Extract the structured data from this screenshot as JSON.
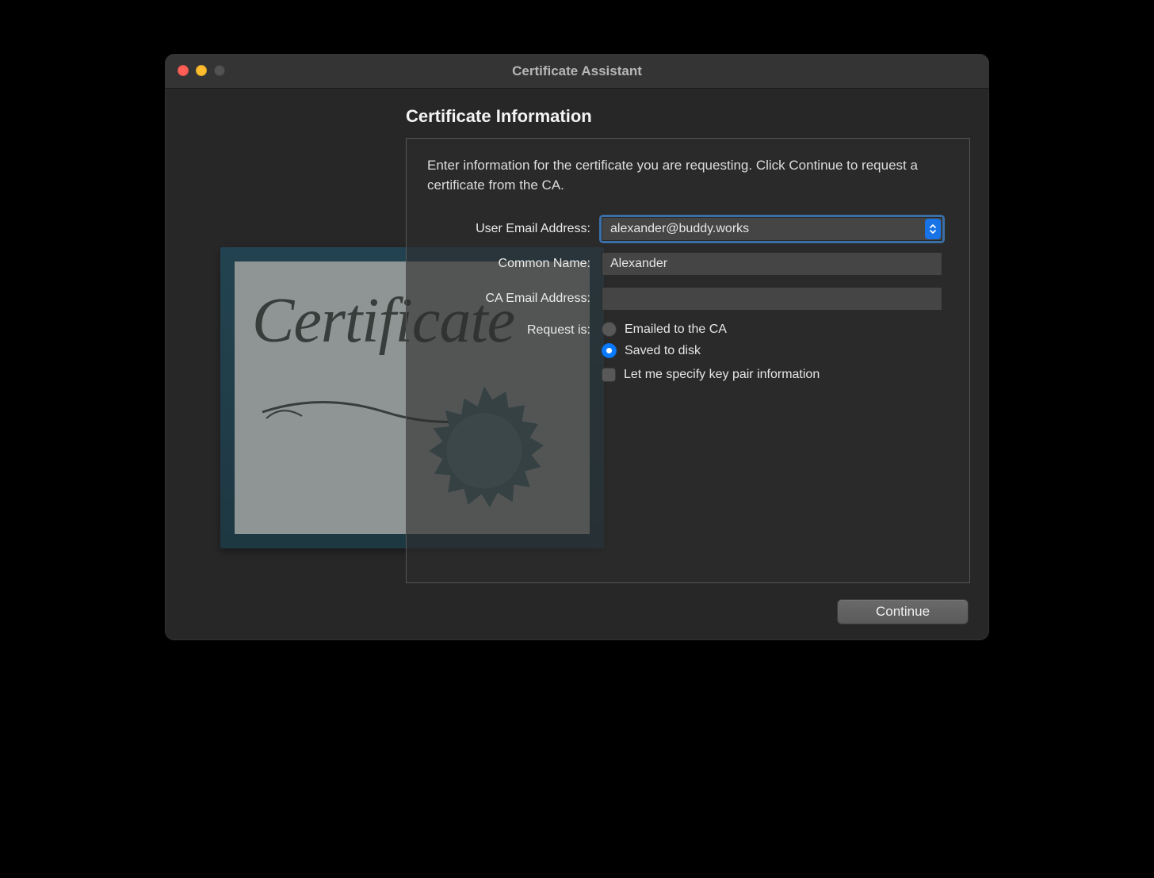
{
  "window": {
    "title": "Certificate Assistant"
  },
  "heading": "Certificate Information",
  "intro": "Enter information for the certificate you are requesting. Click Continue to request a certificate from the CA.",
  "form": {
    "email_label": "User Email Address:",
    "email_value": "alexander@buddy.works",
    "common_name_label": "Common Name:",
    "common_name_value": "Alexander",
    "ca_email_label": "CA Email Address:",
    "ca_email_value": "",
    "request_label": "Request is:",
    "radio_emailed": "Emailed to the CA",
    "radio_saved": "Saved to disk",
    "radio_selected": "saved",
    "check_keypair": "Let me specify key pair information",
    "check_keypair_checked": false
  },
  "buttons": {
    "continue": "Continue"
  },
  "decor": {
    "cert_word": "Certificate"
  }
}
